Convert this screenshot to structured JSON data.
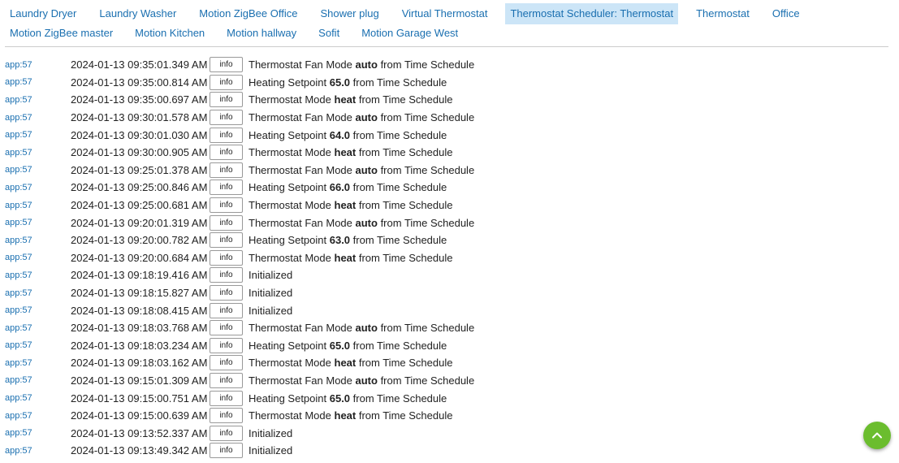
{
  "tabs_row1": [
    {
      "label": "Laundry Dryer",
      "selected": false
    },
    {
      "label": "Laundry Washer",
      "selected": false
    },
    {
      "label": "Motion ZigBee Office",
      "selected": false
    },
    {
      "label": "Shower plug",
      "selected": false
    },
    {
      "label": "Virtual Thermostat",
      "selected": false
    },
    {
      "label": "Thermostat Scheduler: Thermostat",
      "selected": true
    },
    {
      "label": "Thermostat",
      "selected": false
    },
    {
      "label": "Office",
      "selected": false
    }
  ],
  "tabs_row2": [
    {
      "label": "Motion ZigBee master",
      "selected": false
    },
    {
      "label": "Motion Kitchen",
      "selected": false
    },
    {
      "label": "Motion hallway",
      "selected": false
    },
    {
      "label": "Sofit",
      "selected": false
    },
    {
      "label": "Motion Garage West",
      "selected": false
    }
  ],
  "colors": {
    "link": "#1a6fb0",
    "selected_tab_bg": "#cce5f7",
    "fab": "#6bbd2e"
  },
  "fab_icon": "chevron-up-icon",
  "log": [
    {
      "app": "app:57",
      "time": "2024-01-13 09:35:01.349 AM",
      "level": "info",
      "pre": "Thermostat Fan Mode ",
      "bold": "auto",
      "post": " from Time Schedule"
    },
    {
      "app": "app:57",
      "time": "2024-01-13 09:35:00.814 AM",
      "level": "info",
      "pre": "Heating Setpoint ",
      "bold": "65.0",
      "post": " from Time Schedule"
    },
    {
      "app": "app:57",
      "time": "2024-01-13 09:35:00.697 AM",
      "level": "info",
      "pre": "Thermostat Mode ",
      "bold": "heat",
      "post": " from Time Schedule"
    },
    {
      "app": "app:57",
      "time": "2024-01-13 09:30:01.578 AM",
      "level": "info",
      "pre": "Thermostat Fan Mode ",
      "bold": "auto",
      "post": " from Time Schedule"
    },
    {
      "app": "app:57",
      "time": "2024-01-13 09:30:01.030 AM",
      "level": "info",
      "pre": "Heating Setpoint ",
      "bold": "64.0",
      "post": " from Time Schedule"
    },
    {
      "app": "app:57",
      "time": "2024-01-13 09:30:00.905 AM",
      "level": "info",
      "pre": "Thermostat Mode ",
      "bold": "heat",
      "post": " from Time Schedule"
    },
    {
      "app": "app:57",
      "time": "2024-01-13 09:25:01.378 AM",
      "level": "info",
      "pre": "Thermostat Fan Mode ",
      "bold": "auto",
      "post": " from Time Schedule"
    },
    {
      "app": "app:57",
      "time": "2024-01-13 09:25:00.846 AM",
      "level": "info",
      "pre": "Heating Setpoint ",
      "bold": "66.0",
      "post": " from Time Schedule"
    },
    {
      "app": "app:57",
      "time": "2024-01-13 09:25:00.681 AM",
      "level": "info",
      "pre": "Thermostat Mode ",
      "bold": "heat",
      "post": " from Time Schedule"
    },
    {
      "app": "app:57",
      "time": "2024-01-13 09:20:01.319 AM",
      "level": "info",
      "pre": "Thermostat Fan Mode ",
      "bold": "auto",
      "post": " from Time Schedule"
    },
    {
      "app": "app:57",
      "time": "2024-01-13 09:20:00.782 AM",
      "level": "info",
      "pre": "Heating Setpoint ",
      "bold": "63.0",
      "post": " from Time Schedule"
    },
    {
      "app": "app:57",
      "time": "2024-01-13 09:20:00.684 AM",
      "level": "info",
      "pre": "Thermostat Mode ",
      "bold": "heat",
      "post": " from Time Schedule"
    },
    {
      "app": "app:57",
      "time": "2024-01-13 09:18:19.416 AM",
      "level": "info",
      "pre": "Initialized",
      "bold": "",
      "post": ""
    },
    {
      "app": "app:57",
      "time": "2024-01-13 09:18:15.827 AM",
      "level": "info",
      "pre": "Initialized",
      "bold": "",
      "post": ""
    },
    {
      "app": "app:57",
      "time": "2024-01-13 09:18:08.415 AM",
      "level": "info",
      "pre": "Initialized",
      "bold": "",
      "post": ""
    },
    {
      "app": "app:57",
      "time": "2024-01-13 09:18:03.768 AM",
      "level": "info",
      "pre": "Thermostat Fan Mode ",
      "bold": "auto",
      "post": " from Time Schedule"
    },
    {
      "app": "app:57",
      "time": "2024-01-13 09:18:03.234 AM",
      "level": "info",
      "pre": "Heating Setpoint ",
      "bold": "65.0",
      "post": " from Time Schedule"
    },
    {
      "app": "app:57",
      "time": "2024-01-13 09:18:03.162 AM",
      "level": "info",
      "pre": "Thermostat Mode ",
      "bold": "heat",
      "post": " from Time Schedule"
    },
    {
      "app": "app:57",
      "time": "2024-01-13 09:15:01.309 AM",
      "level": "info",
      "pre": "Thermostat Fan Mode ",
      "bold": "auto",
      "post": " from Time Schedule"
    },
    {
      "app": "app:57",
      "time": "2024-01-13 09:15:00.751 AM",
      "level": "info",
      "pre": "Heating Setpoint ",
      "bold": "65.0",
      "post": " from Time Schedule"
    },
    {
      "app": "app:57",
      "time": "2024-01-13 09:15:00.639 AM",
      "level": "info",
      "pre": "Thermostat Mode ",
      "bold": "heat",
      "post": " from Time Schedule"
    },
    {
      "app": "app:57",
      "time": "2024-01-13 09:13:52.337 AM",
      "level": "info",
      "pre": "Initialized",
      "bold": "",
      "post": ""
    },
    {
      "app": "app:57",
      "time": "2024-01-13 09:13:49.342 AM",
      "level": "info",
      "pre": "Initialized",
      "bold": "",
      "post": ""
    }
  ]
}
